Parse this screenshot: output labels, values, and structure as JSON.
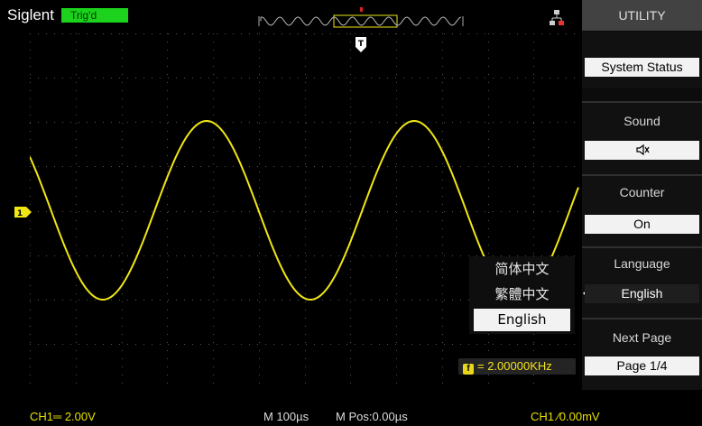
{
  "header": {
    "brand": "Siglent",
    "trigger_status": "Trig'd"
  },
  "waveform": {
    "channel_marker": "1",
    "trigger_marker": "T",
    "color": "#f0e614"
  },
  "language_popup": {
    "options": [
      "简体中文",
      "繁體中文",
      "English"
    ],
    "selected": "English"
  },
  "frequency": {
    "label": "= 2.00000KHz"
  },
  "menu": {
    "title": "UTILITY",
    "items": [
      {
        "label": "",
        "value": "System Status"
      },
      {
        "label": "Sound",
        "value": ""
      },
      {
        "label": "Counter",
        "value": "On"
      },
      {
        "label": "Language",
        "value": "English"
      },
      {
        "label": "Next Page",
        "value": "Page 1/4"
      }
    ]
  },
  "footer": {
    "ch1_scale": "CH1═ 2.00V",
    "timebase": "M 100µs",
    "mpos": "M Pos:0.00µs",
    "trigger": "CH1 ∕0.00mV"
  },
  "colors": {
    "trace": "#f0e614",
    "trig_badge": "#1cd21c",
    "menu_bg": "#0c0c0c",
    "menu_value_bg": "#f2f2f2"
  }
}
